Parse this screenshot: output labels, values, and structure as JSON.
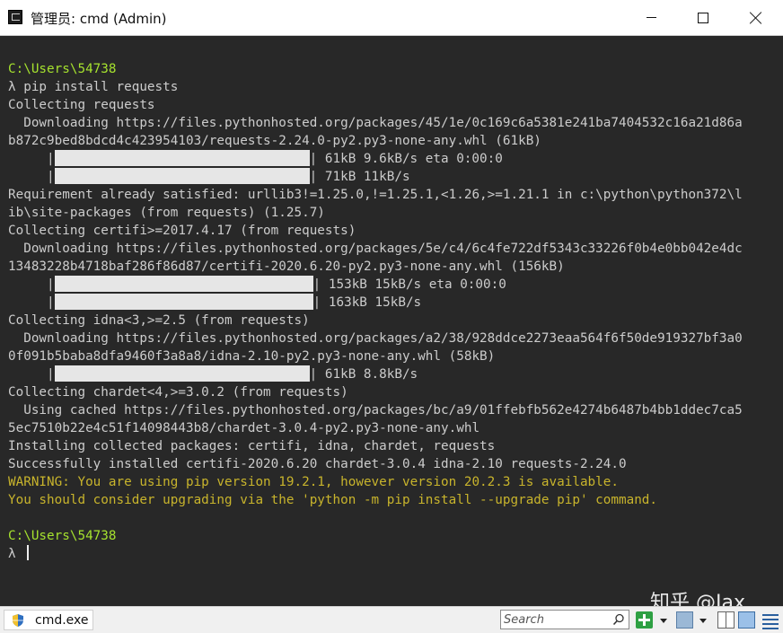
{
  "window": {
    "title": "管理员: cmd (Admin)"
  },
  "console": {
    "lines": [
      {
        "text": "C:\\Users\\54738",
        "color": "green"
      },
      {
        "text": "λ pip install requests"
      },
      {
        "text": "Collecting requests"
      },
      {
        "text": "  Downloading https://files.pythonhosted.org/packages/45/1e/0c169c6a5381e241ba7404532c16a21d86a"
      },
      {
        "text": "b872c9bed8bdcd4c423954103/requests-2.24.0-py2.py3-none-any.whl (61kB)"
      },
      {
        "text": "     |",
        "bar": "narrow",
        "tail": "| 61kB 9.6kB/s eta 0:00:0"
      },
      {
        "text": "     |",
        "bar": "narrow",
        "tail": "| 71kB 11kB/s"
      },
      {
        "text": "Requirement already satisfied: urllib3!=1.25.0,!=1.25.1,<1.26,>=1.21.1 in c:\\python\\python372\\l"
      },
      {
        "text": "ib\\site-packages (from requests) (1.25.7)"
      },
      {
        "text": "Collecting certifi>=2017.4.17 (from requests)"
      },
      {
        "text": "  Downloading https://files.pythonhosted.org/packages/5e/c4/6c4fe722df5343c33226f0b4e0bb042e4dc"
      },
      {
        "text": "13483228b4718baf286f86d87/certifi-2020.6.20-py2.py3-none-any.whl (156kB)"
      },
      {
        "text": "     |",
        "bar": "wide",
        "tail": "| 153kB 15kB/s eta 0:00:0"
      },
      {
        "text": "     |",
        "bar": "wide",
        "tail": "| 163kB 15kB/s"
      },
      {
        "text": "Collecting idna<3,>=2.5 (from requests)"
      },
      {
        "text": "  Downloading https://files.pythonhosted.org/packages/a2/38/928ddce2273eaa564f6f50de919327bf3a0"
      },
      {
        "text": "0f091b5baba8dfa9460f3a8a8/idna-2.10-py2.py3-none-any.whl (58kB)"
      },
      {
        "text": "     |",
        "bar": "narrow",
        "tail": "| 61kB 8.8kB/s"
      },
      {
        "text": "Collecting chardet<4,>=3.0.2 (from requests)"
      },
      {
        "text": "  Using cached https://files.pythonhosted.org/packages/bc/a9/01ffebfb562e4274b6487b4bb1ddec7ca5"
      },
      {
        "text": "5ec7510b22e4c51f14098443b8/chardet-3.0.4-py2.py3-none-any.whl"
      },
      {
        "text": "Installing collected packages: certifi, idna, chardet, requests"
      },
      {
        "text": "Successfully installed certifi-2020.6.20 chardet-3.0.4 idna-2.10 requests-2.24.0"
      },
      {
        "text": "WARNING: You are using pip version 19.2.1, however version 20.2.3 is available.",
        "color": "yellow"
      },
      {
        "text": "You should consider upgrading via the 'python -m pip install --upgrade pip' command.",
        "color": "yellow"
      },
      {
        "text": ""
      },
      {
        "text": "C:\\Users\\54738",
        "color": "green"
      },
      {
        "text": "λ ",
        "cursor": true
      }
    ],
    "watermark": "知乎 @Jax",
    "colors": {
      "prompt": "#a6e22e",
      "warning": "#c8b42c",
      "text": "#cccccc",
      "background": "#282828"
    }
  },
  "statusbar": {
    "tab_label": "cmd.exe",
    "search_placeholder": "Search",
    "icons": [
      "shield-icon",
      "search-icon",
      "new-console-icon",
      "window-icon",
      "split-icon",
      "grid-icon",
      "menu-icon"
    ]
  }
}
